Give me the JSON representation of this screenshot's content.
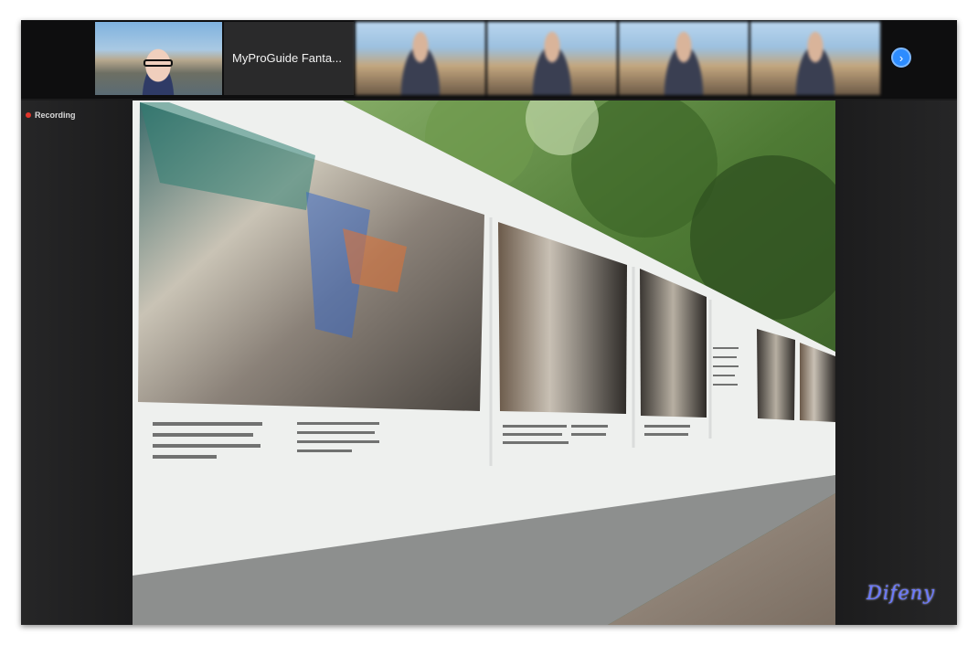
{
  "participants": {
    "self_tile": {
      "icon": "participant-video-icon"
    },
    "name_tile": {
      "label": "MyProGuide Fanta..."
    },
    "blurred_tiles": 4,
    "next_button": {
      "icon": "chevron-right-icon",
      "glyph": "›"
    }
  },
  "status": {
    "recording_label": "Recording",
    "recording_color": "#e0352b"
  },
  "share": {
    "caption_primary": "Sculptures des parties hautes fragilisées par l'incendie et déposées en vue de leur restauration."
  },
  "watermark": {
    "text": "Difeny"
  },
  "colors": {
    "accent": "#2d8cff",
    "background": "#1b1b1c"
  }
}
